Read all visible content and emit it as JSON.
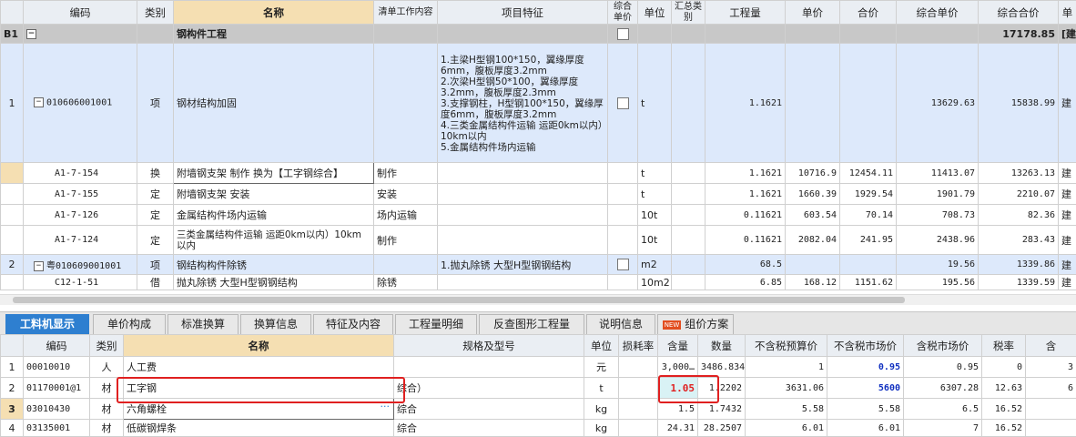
{
  "top": {
    "headers": {
      "code": "编码",
      "cat": "类别",
      "name": "名称",
      "work": "清单工作内容",
      "feature": "项目特征",
      "composite": "综合单价",
      "unit": "单位",
      "summary": "汇总类别",
      "qty": "工程量",
      "price": "单价",
      "total": "合价",
      "cprice": "综合单价",
      "ctotal": "综合合价",
      "more": "单"
    },
    "section": {
      "label": "B1",
      "name": "钢构件工程",
      "ctotal": "17178.85",
      "more": "[建"
    },
    "row1": {
      "num": "1",
      "code": "010606001001",
      "cat": "项",
      "name": "钢材结构加固",
      "feature": "1.主梁H型钢100*150，翼缘厚度6mm，腹板厚度3.2mm\n2.次梁H型钢50*100，翼缘厚度3.2mm，腹板厚度2.3mm\n3.支撑钢柱，H型钢100*150，翼缘厚度6mm，腹板厚度3.2mm\n4.三类金属结构件运输 运距0km以内）10km以内\n5.金属结构件场内运输",
      "unit": "t",
      "qty": "1.1621",
      "cprice": "13629.63",
      "ctotal": "15838.99",
      "more": "建"
    },
    "subrows": [
      {
        "code": "A1-7-154",
        "cat": "换",
        "name": "附墙钢支架 制作  换为【工字钢综合】",
        "work": "制作",
        "unit": "t",
        "qty": "1.1621",
        "price": "10716.9",
        "total": "12454.11",
        "cprice": "11413.07",
        "ctotal": "13263.13",
        "more": "建"
      },
      {
        "code": "A1-7-155",
        "cat": "定",
        "name": "附墙钢支架 安装",
        "work": "安装",
        "unit": "t",
        "qty": "1.1621",
        "price": "1660.39",
        "total": "1929.54",
        "cprice": "1901.79",
        "ctotal": "2210.07",
        "more": "建"
      },
      {
        "code": "A1-7-126",
        "cat": "定",
        "name": "金属结构件场内运输",
        "work": "场内运输",
        "unit": "10t",
        "qty": "0.11621",
        "price": "603.54",
        "total": "70.14",
        "cprice": "708.73",
        "ctotal": "82.36",
        "more": "建"
      },
      {
        "code": "A1-7-124",
        "cat": "定",
        "name": "三类金属结构件运输 运距0km以内）10km以内",
        "work": "制作",
        "unit": "10t",
        "qty": "0.11621",
        "price": "2082.04",
        "total": "241.95",
        "cprice": "2438.96",
        "ctotal": "283.43",
        "more": "建"
      }
    ],
    "row2": {
      "num": "2",
      "code": "粤010609001001",
      "cat": "项",
      "name": "钢结构构件除锈",
      "feature": "1.抛丸除锈 大型H型钢钢结构",
      "unit": "m2",
      "qty": "68.5",
      "cprice": "19.56",
      "ctotal": "1339.86",
      "more": "建"
    },
    "row3": {
      "code": "C12-1-51",
      "cat": "借",
      "name": "抛丸除锈 大型H型钢钢结构",
      "work": "除锈",
      "unit": "10m2",
      "qty": "6.85",
      "price": "168.12",
      "total": "1151.62",
      "cprice": "195.56",
      "ctotal": "1339.59",
      "more": "建"
    }
  },
  "tabs": [
    "工料机显示",
    "单价构成",
    "标准换算",
    "换算信息",
    "特征及内容",
    "工程量明细",
    "反查图形工程量",
    "说明信息",
    "组价方案"
  ],
  "new_badge": "NEW",
  "bottom": {
    "headers": {
      "code": "编码",
      "cat": "类别",
      "name": "名称",
      "spec": "规格及型号",
      "unit": "单位",
      "loss": "损耗率",
      "content": "含量",
      "qty": "数量",
      "pre_tax": "不含税预算价",
      "market": "不含税市场价",
      "tax_market": "含税市场价",
      "rate": "税率",
      "more": "含"
    },
    "rows": [
      {
        "num": "1",
        "code": "00010010",
        "cat": "人",
        "name": "人工费",
        "spec": "",
        "unit": "元",
        "content": "3,000…",
        "qty": "3486.8346",
        "pre_tax": "1",
        "market": "0.95",
        "tax_market": "0.95",
        "rate": "0",
        "more": "3"
      },
      {
        "num": "2",
        "code": "01170001@1",
        "cat": "材",
        "name": "工字钢",
        "spec": "综合）",
        "unit": "t",
        "content": "1.05",
        "qty": "1.2202",
        "pre_tax": "3631.06",
        "market": "5600",
        "tax_market": "6307.28",
        "rate": "12.63",
        "more": "6"
      },
      {
        "num": "3",
        "code": "03010430",
        "cat": "材",
        "name": "六角螺栓",
        "spec": "综合",
        "unit": "kg",
        "content": "1.5",
        "qty": "1.7432",
        "pre_tax": "5.58",
        "market": "5.58",
        "tax_market": "6.5",
        "rate": "16.52",
        "more": ""
      },
      {
        "num": "4",
        "code": "03135001",
        "cat": "材",
        "name": "低碳钢焊条",
        "spec": "综合",
        "unit": "kg",
        "content": "24.31",
        "qty": "28.2507",
        "pre_tax": "6.01",
        "market": "6.01",
        "tax_market": "7",
        "rate": "16.52",
        "more": ""
      }
    ]
  },
  "colors": {
    "accent": "#2e7fd0",
    "highlight_red": "#e02020",
    "blue_value": "#1030c0",
    "selected_row": "#dde9fb",
    "section_row": "#c8c8c8"
  },
  "icons": {
    "tree_collapse": "minus-box-icon",
    "checkbox": "checkbox-icon",
    "ellipsis": "ellipsis-icon"
  }
}
